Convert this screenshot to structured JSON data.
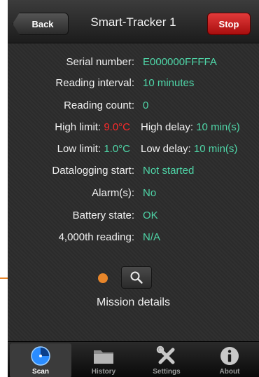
{
  "nav": {
    "back_label": "Back",
    "title": "Smart-Tracker 1",
    "stop_label": "Stop"
  },
  "info": {
    "serial_label": "Serial number:",
    "serial_value": "E000000FFFFA",
    "interval_label": "Reading interval:",
    "interval_value": "10 minutes",
    "count_label": "Reading count:",
    "count_value": "0",
    "high_limit_label": "High limit: ",
    "high_limit_value": "9.0°C",
    "high_delay_label": "High delay: ",
    "high_delay_value": "10 min(s)",
    "low_limit_label": "Low limit: ",
    "low_limit_value": "1.0°C",
    "low_delay_label": "Low delay: ",
    "low_delay_value": "10 min(s)",
    "datalog_label": "Datalogging start:",
    "datalog_value": "Not started",
    "alarm_label": "Alarm(s):",
    "alarm_value": "No",
    "battery_label": "Battery state:",
    "battery_value": "OK",
    "reading4000_label": "4,000th reading:",
    "reading4000_value": "N/A"
  },
  "mission": {
    "label": "Mission details",
    "icon": "search-icon"
  },
  "tabs": [
    {
      "label": "Scan",
      "icon": "scan-icon",
      "active": true
    },
    {
      "label": "History",
      "icon": "folder-icon",
      "active": false
    },
    {
      "label": "Settings",
      "icon": "tools-icon",
      "active": false
    },
    {
      "label": "About",
      "icon": "info-icon",
      "active": false
    }
  ],
  "colors": {
    "value_teal": "#4fd6a8",
    "limit_red": "#ff2a2a",
    "stop_red": "#c41e1e",
    "annotation_orange": "#e8862a",
    "scan_blue": "#2a8cff"
  }
}
